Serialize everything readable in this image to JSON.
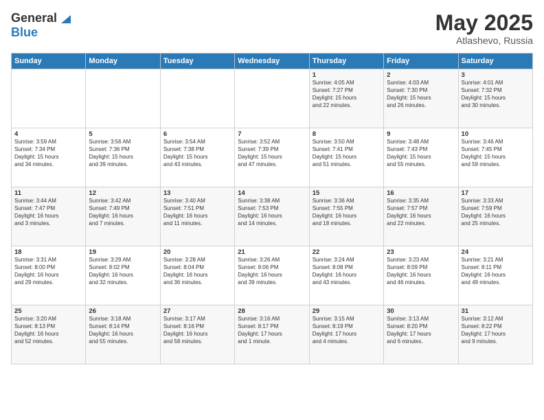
{
  "header": {
    "logo_general": "General",
    "logo_blue": "Blue",
    "month": "May 2025",
    "location": "Atlashevo, Russia"
  },
  "weekdays": [
    "Sunday",
    "Monday",
    "Tuesday",
    "Wednesday",
    "Thursday",
    "Friday",
    "Saturday"
  ],
  "weeks": [
    [
      {
        "day": "",
        "text": ""
      },
      {
        "day": "",
        "text": ""
      },
      {
        "day": "",
        "text": ""
      },
      {
        "day": "",
        "text": ""
      },
      {
        "day": "1",
        "text": "Sunrise: 4:05 AM\nSunset: 7:27 PM\nDaylight: 15 hours\nand 22 minutes."
      },
      {
        "day": "2",
        "text": "Sunrise: 4:03 AM\nSunset: 7:30 PM\nDaylight: 15 hours\nand 26 minutes."
      },
      {
        "day": "3",
        "text": "Sunrise: 4:01 AM\nSunset: 7:32 PM\nDaylight: 15 hours\nand 30 minutes."
      }
    ],
    [
      {
        "day": "4",
        "text": "Sunrise: 3:59 AM\nSunset: 7:34 PM\nDaylight: 15 hours\nand 34 minutes."
      },
      {
        "day": "5",
        "text": "Sunrise: 3:56 AM\nSunset: 7:36 PM\nDaylight: 15 hours\nand 39 minutes."
      },
      {
        "day": "6",
        "text": "Sunrise: 3:54 AM\nSunset: 7:38 PM\nDaylight: 15 hours\nand 43 minutes."
      },
      {
        "day": "7",
        "text": "Sunrise: 3:52 AM\nSunset: 7:39 PM\nDaylight: 15 hours\nand 47 minutes."
      },
      {
        "day": "8",
        "text": "Sunrise: 3:50 AM\nSunset: 7:41 PM\nDaylight: 15 hours\nand 51 minutes."
      },
      {
        "day": "9",
        "text": "Sunrise: 3:48 AM\nSunset: 7:43 PM\nDaylight: 15 hours\nand 55 minutes."
      },
      {
        "day": "10",
        "text": "Sunrise: 3:46 AM\nSunset: 7:45 PM\nDaylight: 15 hours\nand 59 minutes."
      }
    ],
    [
      {
        "day": "11",
        "text": "Sunrise: 3:44 AM\nSunset: 7:47 PM\nDaylight: 16 hours\nand 3 minutes."
      },
      {
        "day": "12",
        "text": "Sunrise: 3:42 AM\nSunset: 7:49 PM\nDaylight: 16 hours\nand 7 minutes."
      },
      {
        "day": "13",
        "text": "Sunrise: 3:40 AM\nSunset: 7:51 PM\nDaylight: 16 hours\nand 11 minutes."
      },
      {
        "day": "14",
        "text": "Sunrise: 3:38 AM\nSunset: 7:53 PM\nDaylight: 16 hours\nand 14 minutes."
      },
      {
        "day": "15",
        "text": "Sunrise: 3:36 AM\nSunset: 7:55 PM\nDaylight: 16 hours\nand 18 minutes."
      },
      {
        "day": "16",
        "text": "Sunrise: 3:35 AM\nSunset: 7:57 PM\nDaylight: 16 hours\nand 22 minutes."
      },
      {
        "day": "17",
        "text": "Sunrise: 3:33 AM\nSunset: 7:59 PM\nDaylight: 16 hours\nand 25 minutes."
      }
    ],
    [
      {
        "day": "18",
        "text": "Sunrise: 3:31 AM\nSunset: 8:00 PM\nDaylight: 16 hours\nand 29 minutes."
      },
      {
        "day": "19",
        "text": "Sunrise: 3:29 AM\nSunset: 8:02 PM\nDaylight: 16 hours\nand 32 minutes."
      },
      {
        "day": "20",
        "text": "Sunrise: 3:28 AM\nSunset: 8:04 PM\nDaylight: 16 hours\nand 36 minutes."
      },
      {
        "day": "21",
        "text": "Sunrise: 3:26 AM\nSunset: 8:06 PM\nDaylight: 16 hours\nand 39 minutes."
      },
      {
        "day": "22",
        "text": "Sunrise: 3:24 AM\nSunset: 8:08 PM\nDaylight: 16 hours\nand 43 minutes."
      },
      {
        "day": "23",
        "text": "Sunrise: 3:23 AM\nSunset: 8:09 PM\nDaylight: 16 hours\nand 46 minutes."
      },
      {
        "day": "24",
        "text": "Sunrise: 3:21 AM\nSunset: 8:11 PM\nDaylight: 16 hours\nand 49 minutes."
      }
    ],
    [
      {
        "day": "25",
        "text": "Sunrise: 3:20 AM\nSunset: 8:13 PM\nDaylight: 16 hours\nand 52 minutes."
      },
      {
        "day": "26",
        "text": "Sunrise: 3:18 AM\nSunset: 8:14 PM\nDaylight: 16 hours\nand 55 minutes."
      },
      {
        "day": "27",
        "text": "Sunrise: 3:17 AM\nSunset: 8:16 PM\nDaylight: 16 hours\nand 58 minutes."
      },
      {
        "day": "28",
        "text": "Sunrise: 3:16 AM\nSunset: 8:17 PM\nDaylight: 17 hours\nand 1 minute."
      },
      {
        "day": "29",
        "text": "Sunrise: 3:15 AM\nSunset: 8:19 PM\nDaylight: 17 hours\nand 4 minutes."
      },
      {
        "day": "30",
        "text": "Sunrise: 3:13 AM\nSunset: 8:20 PM\nDaylight: 17 hours\nand 6 minutes."
      },
      {
        "day": "31",
        "text": "Sunrise: 3:12 AM\nSunset: 8:22 PM\nDaylight: 17 hours\nand 9 minutes."
      }
    ]
  ]
}
